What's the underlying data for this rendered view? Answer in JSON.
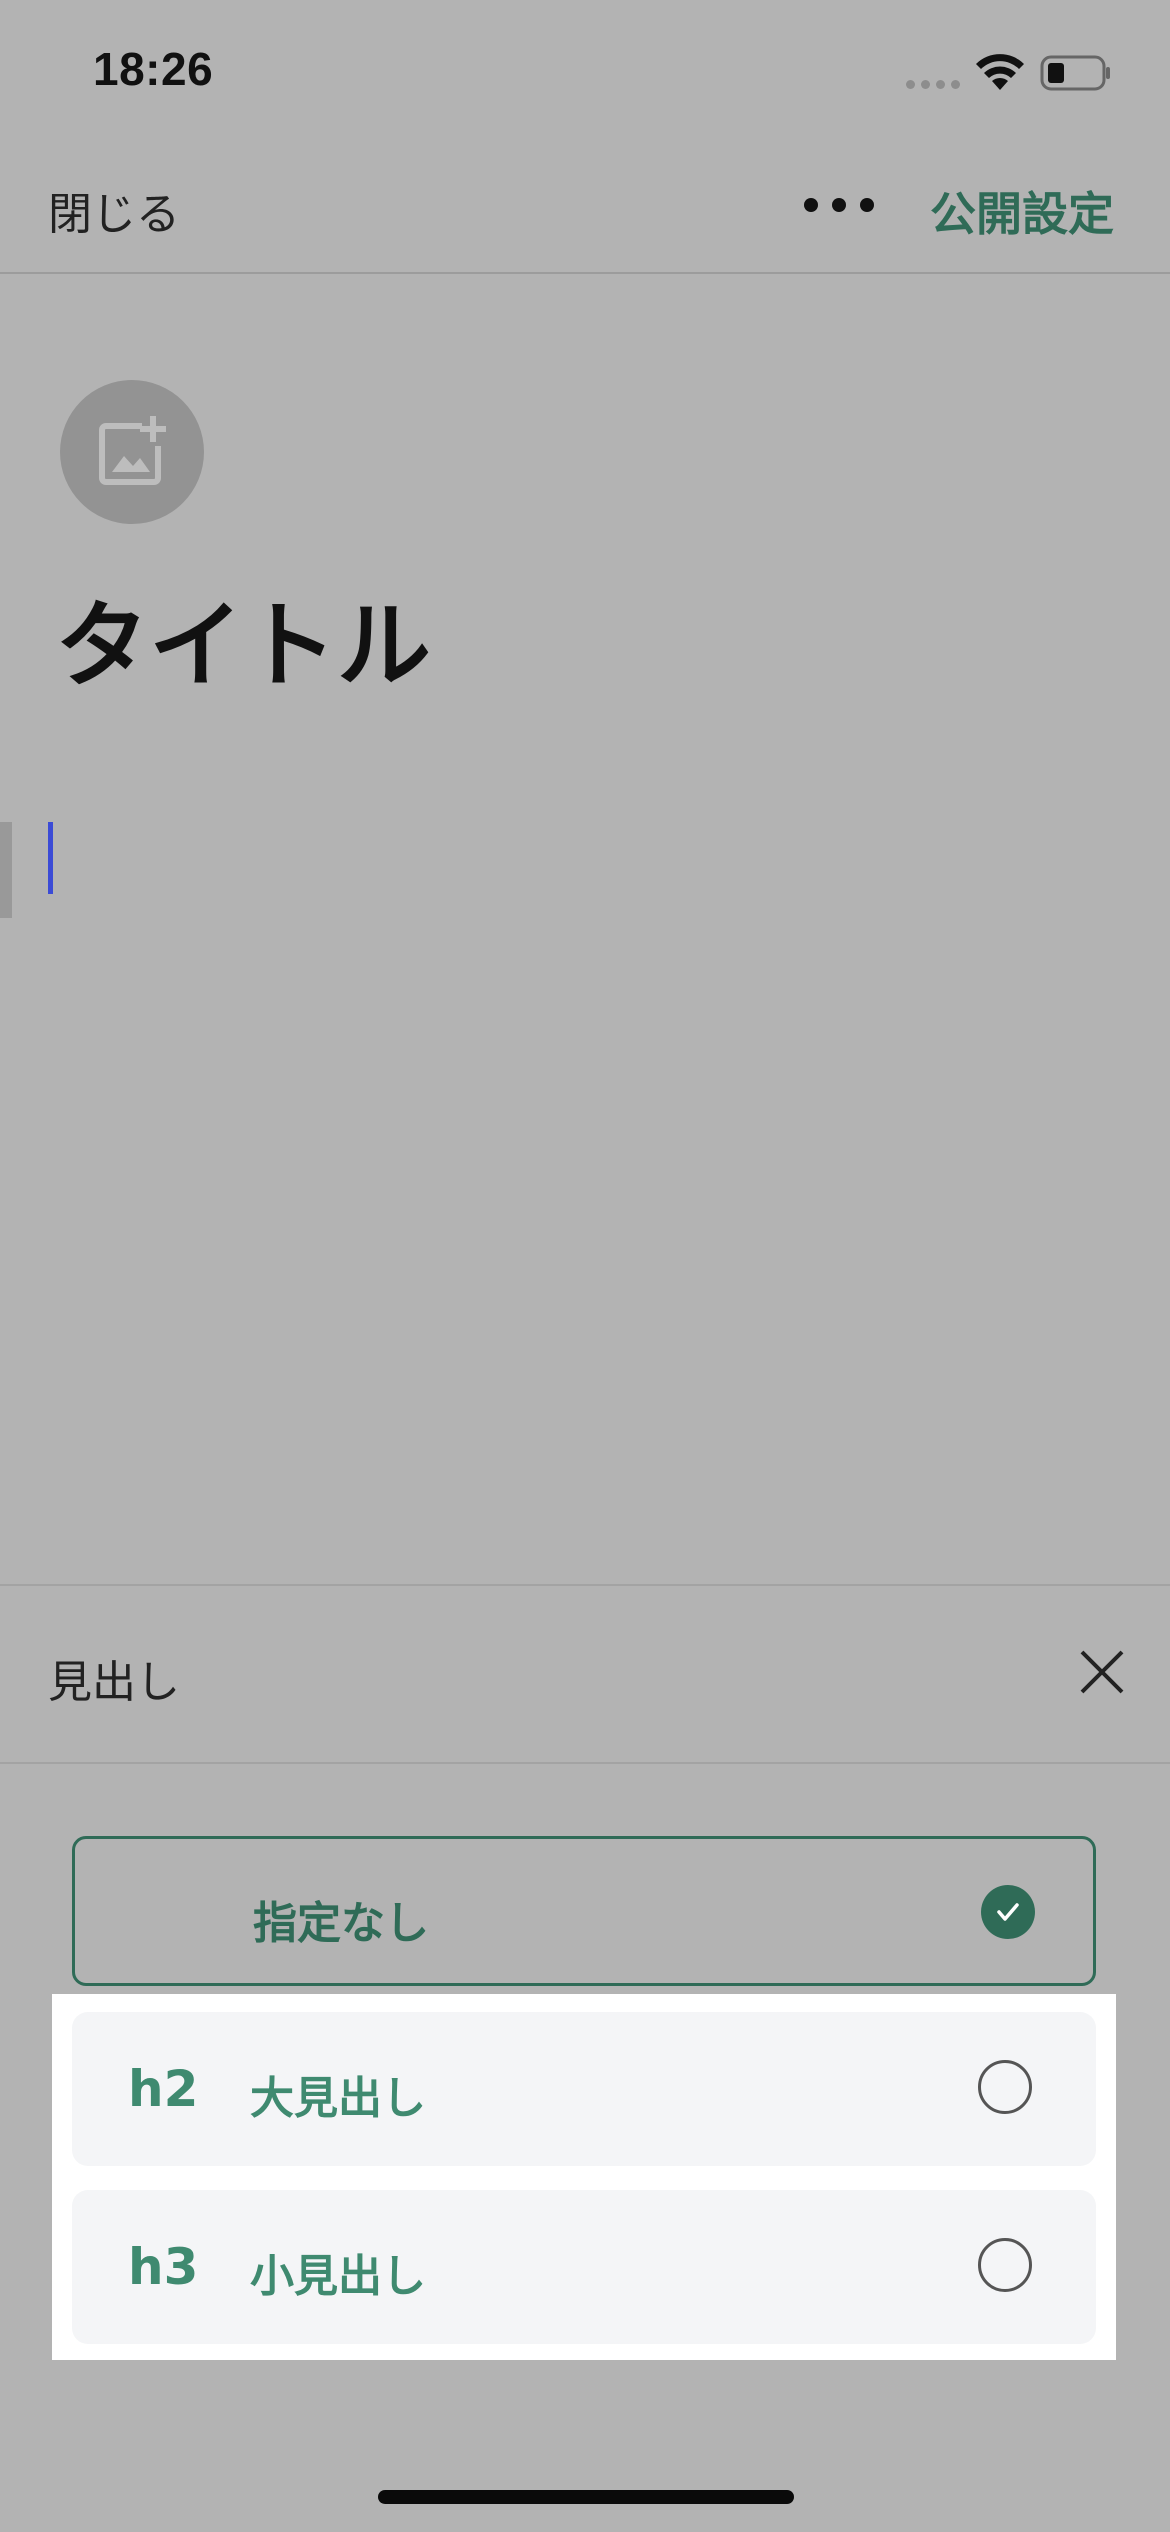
{
  "status_bar": {
    "time": "18:26"
  },
  "nav": {
    "close_label": "閉じる",
    "publish_label": "公開設定"
  },
  "editor": {
    "title": "タイトル"
  },
  "heading_panel": {
    "title": "見出し",
    "options": [
      {
        "tag": "",
        "label": "指定なし",
        "selected": true
      },
      {
        "tag": "h2",
        "label": "大見出し",
        "selected": false
      },
      {
        "tag": "h3",
        "label": "小見出し",
        "selected": false
      }
    ]
  },
  "colors": {
    "accent": "#2f6b57",
    "accent_light": "#3f8a70",
    "overlay_bg": "#b3b3b3",
    "cursor": "#3b4bd6"
  }
}
